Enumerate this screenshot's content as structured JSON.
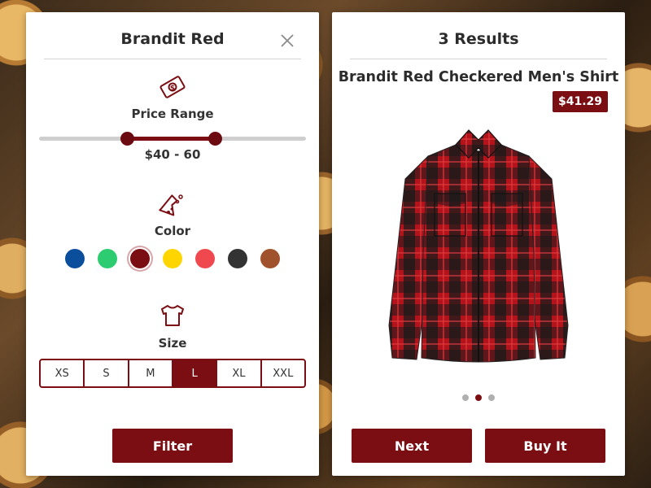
{
  "filter_panel": {
    "title": "Brandit Red",
    "price": {
      "label": "Price Range",
      "value_text": "$40 - 60",
      "range_fraction": [
        0.33,
        0.66
      ]
    },
    "color": {
      "label": "Color",
      "swatches": [
        {
          "name": "blue",
          "hex": "#0b4e9c"
        },
        {
          "name": "green",
          "hex": "#2ecc71"
        },
        {
          "name": "dark-red",
          "hex": "#7a0e13",
          "selected": true
        },
        {
          "name": "yellow",
          "hex": "#ffd500"
        },
        {
          "name": "light-red",
          "hex": "#f0484f"
        },
        {
          "name": "dark-gray",
          "hex": "#333333"
        },
        {
          "name": "brown",
          "hex": "#a0522d"
        }
      ]
    },
    "size": {
      "label": "Size",
      "options": [
        "XS",
        "S",
        "M",
        "L",
        "XL",
        "XXL"
      ],
      "selected": "L"
    },
    "filter_button": "Filter"
  },
  "results_panel": {
    "title": "3 Results",
    "product_name": "Brandit Red Checkered Men's Shirt",
    "price": "$41.29",
    "carousel": {
      "count": 3,
      "active_index": 1
    },
    "next_button": "Next",
    "buy_button": "Buy It"
  },
  "colors": {
    "accent": "#7a0e13",
    "track": "#cfcfcf"
  }
}
